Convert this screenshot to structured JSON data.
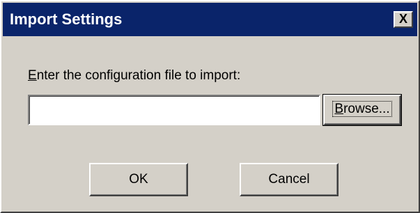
{
  "window": {
    "title": "Import Settings",
    "close_label": "X"
  },
  "form": {
    "prompt_access_key": "E",
    "prompt_rest": "nter the configuration file to import:",
    "file_value": "",
    "file_placeholder": ""
  },
  "buttons": {
    "browse_access_key": "B",
    "browse_rest": "rowse...",
    "ok_label": "OK",
    "cancel_label": "Cancel"
  },
  "colors": {
    "titlebar": "#0a246a",
    "dialog_face": "#d4d0c8"
  }
}
